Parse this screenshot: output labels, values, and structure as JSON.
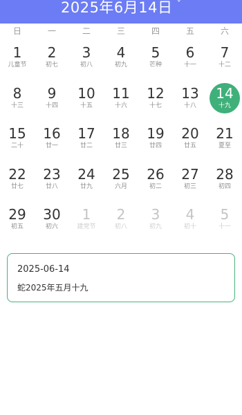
{
  "header": {
    "title": "2025年6月14日",
    "chevron_icon": "chevron-down-icon",
    "chevron_glyph": "ˇ",
    "background_color": "#6b7cf5"
  },
  "weekdays": [
    "日",
    "一",
    "二",
    "三",
    "四",
    "五",
    "六"
  ],
  "selected_color": "#3fb07a",
  "days": [
    {
      "day": "1",
      "lunar": "儿童节",
      "current": true
    },
    {
      "day": "2",
      "lunar": "初七",
      "current": true
    },
    {
      "day": "3",
      "lunar": "初八",
      "current": true
    },
    {
      "day": "4",
      "lunar": "初九",
      "current": true
    },
    {
      "day": "5",
      "lunar": "芒种",
      "current": true
    },
    {
      "day": "6",
      "lunar": "十一",
      "current": true
    },
    {
      "day": "7",
      "lunar": "十二",
      "current": true
    },
    {
      "day": "8",
      "lunar": "十三",
      "current": true
    },
    {
      "day": "9",
      "lunar": "十四",
      "current": true
    },
    {
      "day": "10",
      "lunar": "十五",
      "current": true
    },
    {
      "day": "11",
      "lunar": "十六",
      "current": true
    },
    {
      "day": "12",
      "lunar": "十七",
      "current": true
    },
    {
      "day": "13",
      "lunar": "十八",
      "current": true
    },
    {
      "day": "14",
      "lunar": "十九",
      "current": true,
      "selected": true
    },
    {
      "day": "15",
      "lunar": "二十",
      "current": true
    },
    {
      "day": "16",
      "lunar": "廿一",
      "current": true
    },
    {
      "day": "17",
      "lunar": "廿二",
      "current": true
    },
    {
      "day": "18",
      "lunar": "廿三",
      "current": true
    },
    {
      "day": "19",
      "lunar": "廿四",
      "current": true
    },
    {
      "day": "20",
      "lunar": "廿五",
      "current": true
    },
    {
      "day": "21",
      "lunar": "夏至",
      "current": true
    },
    {
      "day": "22",
      "lunar": "廿七",
      "current": true
    },
    {
      "day": "23",
      "lunar": "廿八",
      "current": true
    },
    {
      "day": "24",
      "lunar": "廿九",
      "current": true
    },
    {
      "day": "25",
      "lunar": "六月",
      "current": true
    },
    {
      "day": "26",
      "lunar": "初二",
      "current": true
    },
    {
      "day": "27",
      "lunar": "初三",
      "current": true
    },
    {
      "day": "28",
      "lunar": "初四",
      "current": true
    },
    {
      "day": "29",
      "lunar": "初五",
      "current": true
    },
    {
      "day": "30",
      "lunar": "初六",
      "current": true
    },
    {
      "day": "1",
      "lunar": "建党节",
      "current": false
    },
    {
      "day": "2",
      "lunar": "初八",
      "current": false
    },
    {
      "day": "3",
      "lunar": "初九",
      "current": false
    },
    {
      "day": "4",
      "lunar": "初十",
      "current": false
    },
    {
      "day": "5",
      "lunar": "十一",
      "current": false
    }
  ],
  "info": {
    "date": "2025-06-14",
    "lunar": "蛇2025年五月十九",
    "border_color": "#47b07c"
  }
}
